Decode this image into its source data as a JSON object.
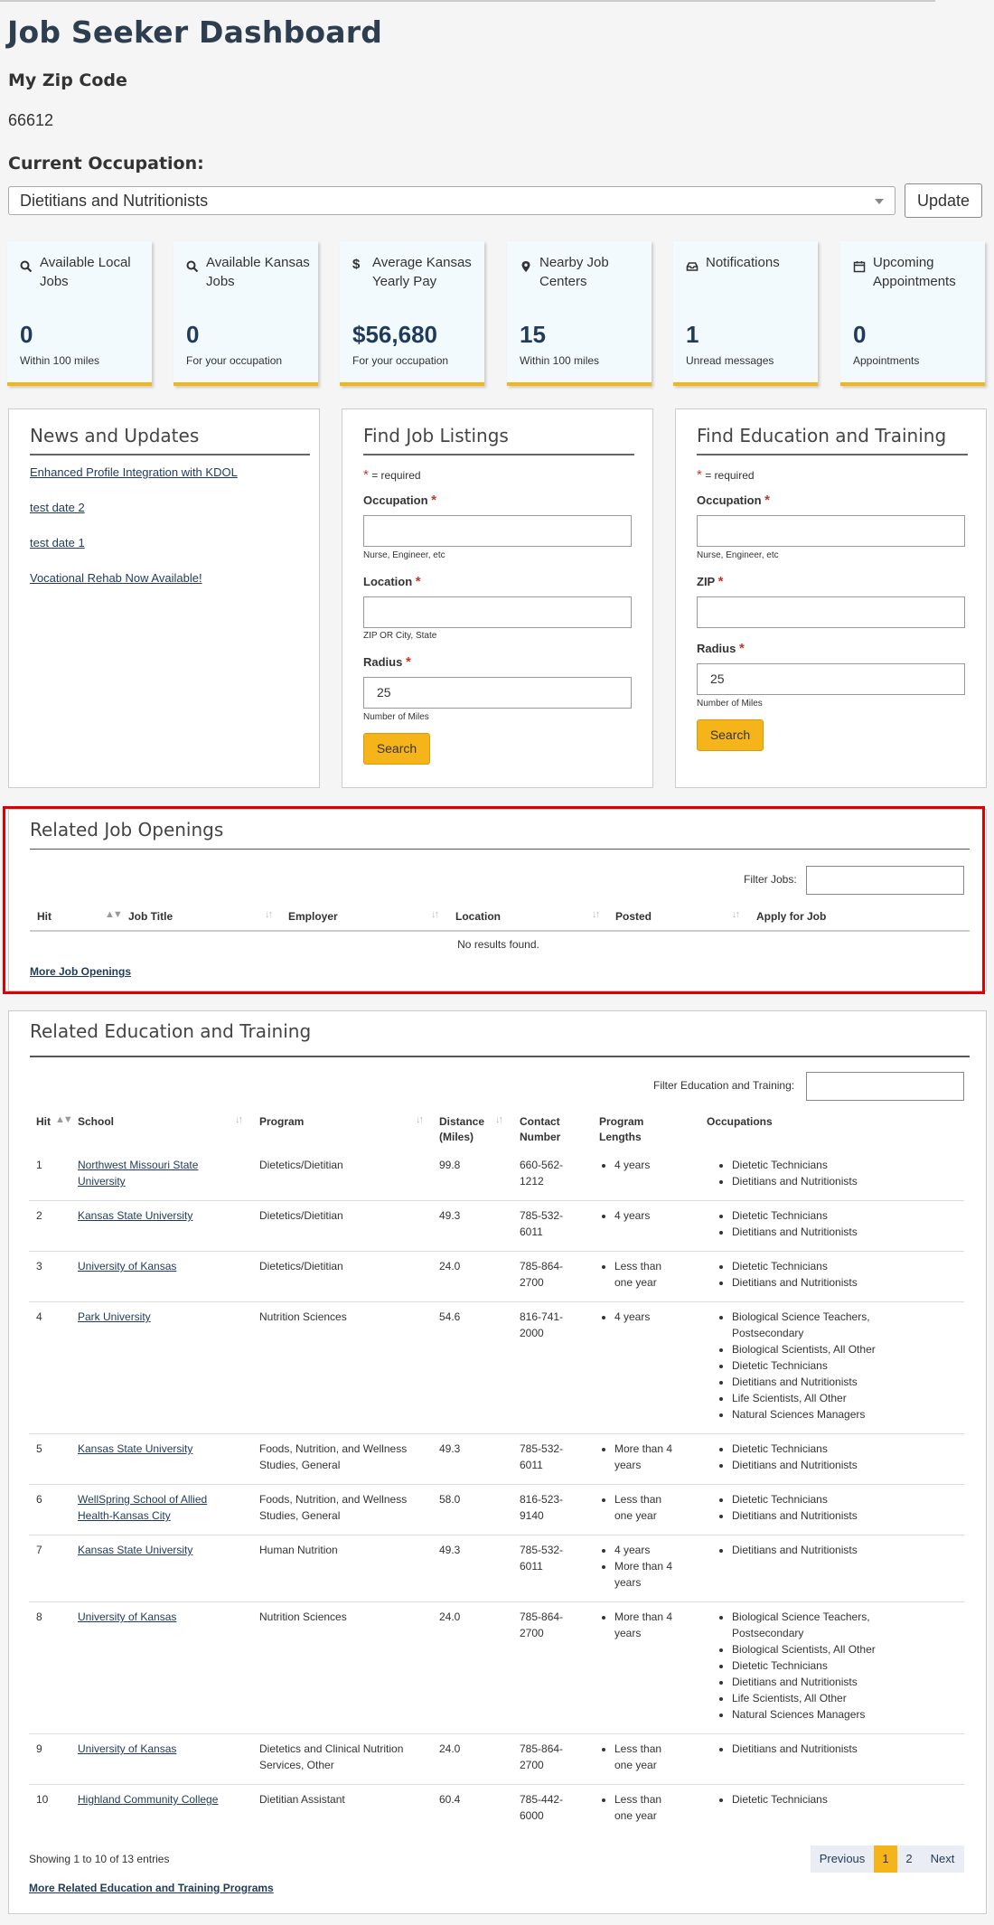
{
  "header": {
    "title": "Job Seeker Dashboard",
    "zip_label": "My Zip Code",
    "zip_value": "66612",
    "occupation_label": "Current Occupation:",
    "occupation_value": "Dietitians and Nutritionists",
    "update_label": "Update"
  },
  "stats": [
    {
      "label": "Available Local Jobs",
      "value": "0",
      "sub": "Within 100 miles",
      "icon": "search-icon"
    },
    {
      "label": "Available Kansas Jobs",
      "value": "0",
      "sub": "For your occupation",
      "icon": "search-icon"
    },
    {
      "label": "Average Kansas Yearly Pay",
      "value": "$56,680",
      "sub": "For your occupation",
      "icon": "dollar-icon"
    },
    {
      "label": "Nearby Job Centers",
      "value": "15",
      "sub": "Within 100 miles",
      "icon": "map-pin-icon"
    },
    {
      "label": "Notifications",
      "value": "1",
      "sub": "Unread messages",
      "icon": "inbox-icon"
    },
    {
      "label": "Upcoming Appointments",
      "value": "0",
      "sub": "Appointments",
      "icon": "calendar-icon"
    }
  ],
  "news": {
    "title": "News and Updates",
    "items": [
      "Enhanced Profile Integration with KDOL",
      "test date 2",
      "test date 1",
      "Vocational Rehab Now Available!"
    ]
  },
  "job_search": {
    "title": "Find Job Listings",
    "required_note": "= required",
    "occupation_label": "Occupation",
    "occupation_help": "Nurse, Engineer, etc",
    "location_label": "Location",
    "location_help": "ZIP OR City, State",
    "radius_label": "Radius",
    "radius_value": "25",
    "radius_help": "Number of Miles",
    "search_label": "Search"
  },
  "edu_search": {
    "title": "Find Education and Training",
    "required_note": "= required",
    "occupation_label": "Occupation",
    "occupation_help": "Nurse, Engineer, etc",
    "zip_label": "ZIP",
    "radius_label": "Radius",
    "radius_value": "25",
    "radius_help": "Number of Miles",
    "search_label": "Search"
  },
  "job_openings": {
    "title": "Related Job Openings",
    "filter_label": "Filter Jobs:",
    "columns": [
      "Hit",
      "Job Title",
      "Employer",
      "Location",
      "Posted",
      "Apply for Job"
    ],
    "empty_text": "No results found.",
    "more_link": "More Job Openings"
  },
  "education": {
    "title": "Related Education and Training",
    "filter_label": "Filter Education and Training:",
    "columns": [
      "Hit",
      "School",
      "Program",
      "Distance (Miles)",
      "Contact Number",
      "Program Lengths",
      "Occupations"
    ],
    "rows": [
      {
        "hit": "1",
        "school": "Northwest Missouri State University",
        "program": "Dietetics/Dietitian",
        "distance": "99.8",
        "contact": "660-562-1212",
        "lengths": [
          "4 years"
        ],
        "occupations": [
          "Dietetic Technicians",
          "Dietitians and Nutritionists"
        ]
      },
      {
        "hit": "2",
        "school": "Kansas State University",
        "program": "Dietetics/Dietitian",
        "distance": "49.3",
        "contact": "785-532-6011",
        "lengths": [
          "4 years"
        ],
        "occupations": [
          "Dietetic Technicians",
          "Dietitians and Nutritionists"
        ]
      },
      {
        "hit": "3",
        "school": "University of Kansas",
        "program": "Dietetics/Dietitian",
        "distance": "24.0",
        "contact": "785-864-2700",
        "lengths": [
          "Less than one year"
        ],
        "occupations": [
          "Dietetic Technicians",
          "Dietitians and Nutritionists"
        ]
      },
      {
        "hit": "4",
        "school": "Park University",
        "program": "Nutrition Sciences",
        "distance": "54.6",
        "contact": "816-741-2000",
        "lengths": [
          "4 years"
        ],
        "occupations": [
          "Biological Science Teachers, Postsecondary",
          "Biological Scientists, All Other",
          "Dietetic Technicians",
          "Dietitians and Nutritionists",
          "Life Scientists, All Other",
          "Natural Sciences Managers"
        ]
      },
      {
        "hit": "5",
        "school": "Kansas State University",
        "program": "Foods, Nutrition, and Wellness Studies, General",
        "distance": "49.3",
        "contact": "785-532-6011",
        "lengths": [
          "More than 4 years"
        ],
        "occupations": [
          "Dietetic Technicians",
          "Dietitians and Nutritionists"
        ]
      },
      {
        "hit": "6",
        "school": "WellSpring School of Allied Health-Kansas City",
        "program": "Foods, Nutrition, and Wellness Studies, General",
        "distance": "58.0",
        "contact": "816-523-9140",
        "lengths": [
          "Less than one year"
        ],
        "occupations": [
          "Dietetic Technicians",
          "Dietitians and Nutritionists"
        ]
      },
      {
        "hit": "7",
        "school": "Kansas State University",
        "program": "Human Nutrition",
        "distance": "49.3",
        "contact": "785-532-6011",
        "lengths": [
          "4 years",
          "More than 4 years"
        ],
        "occupations": [
          "Dietitians and Nutritionists"
        ]
      },
      {
        "hit": "8",
        "school": "University of Kansas",
        "program": "Nutrition Sciences",
        "distance": "24.0",
        "contact": "785-864-2700",
        "lengths": [
          "More than 4 years"
        ],
        "occupations": [
          "Biological Science Teachers, Postsecondary",
          "Biological Scientists, All Other",
          "Dietetic Technicians",
          "Dietitians and Nutritionists",
          "Life Scientists, All Other",
          "Natural Sciences Managers"
        ]
      },
      {
        "hit": "9",
        "school": "University of Kansas",
        "program": "Dietetics and Clinical Nutrition Services, Other",
        "distance": "24.0",
        "contact": "785-864-2700",
        "lengths": [
          "Less than one year"
        ],
        "occupations": [
          "Dietitians and Nutritionists"
        ]
      },
      {
        "hit": "10",
        "school": "Highland Community College",
        "program": "Dietitian Assistant",
        "distance": "60.4",
        "contact": "785-442-6000",
        "lengths": [
          "Less than one year"
        ],
        "occupations": [
          "Dietetic Technicians"
        ]
      }
    ],
    "showing": "Showing 1 to 10 of 13 entries",
    "pagination": {
      "previous": "Previous",
      "pages": [
        "1",
        "2"
      ],
      "next": "Next"
    },
    "more_link": "More Related Education and Training Programs"
  },
  "colors": {
    "accent": "#f5b41a",
    "dark_blue": "#1f3a5a",
    "highlight": "#e00000"
  }
}
